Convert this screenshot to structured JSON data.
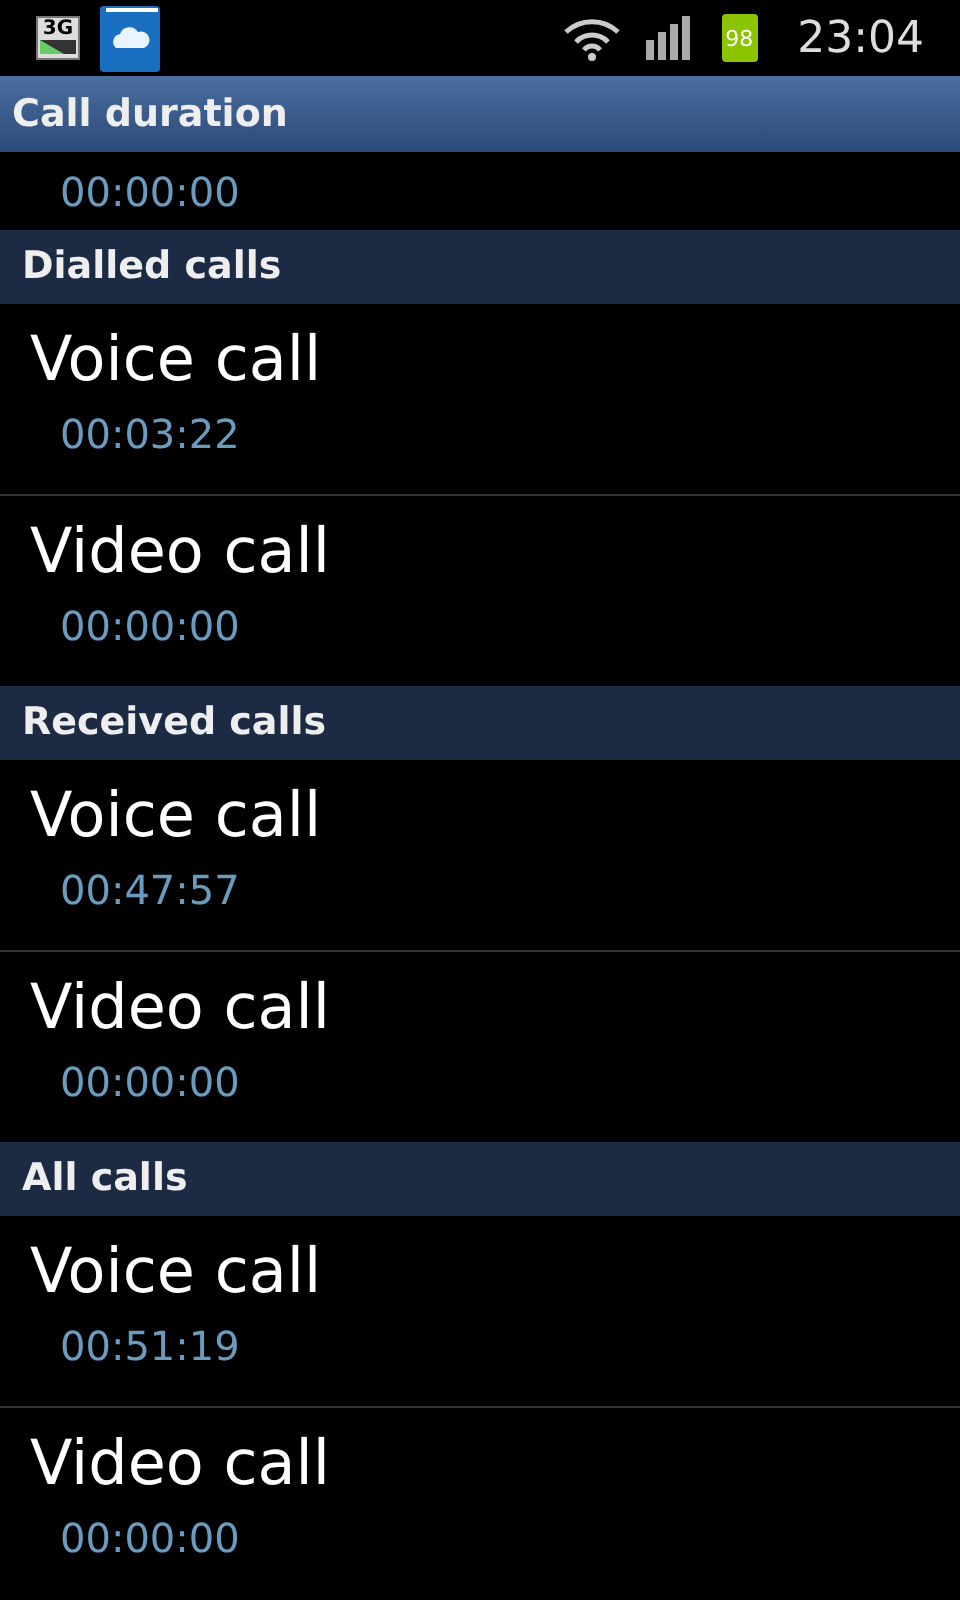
{
  "status_bar": {
    "network_badge": "3G",
    "battery": "98",
    "time": "23:04"
  },
  "title": "Call duration",
  "last_call": "00:00:00",
  "sections": [
    {
      "header": "Dialled calls",
      "items": [
        {
          "label": "Voice call",
          "duration": "00:03:22"
        },
        {
          "label": "Video call",
          "duration": "00:00:00"
        }
      ]
    },
    {
      "header": "Received calls",
      "items": [
        {
          "label": "Voice call",
          "duration": "00:47:57"
        },
        {
          "label": "Video call",
          "duration": "00:00:00"
        }
      ]
    },
    {
      "header": "All calls",
      "items": [
        {
          "label": "Voice call",
          "duration": "00:51:19"
        },
        {
          "label": "Video call",
          "duration": "00:00:00"
        }
      ]
    }
  ]
}
